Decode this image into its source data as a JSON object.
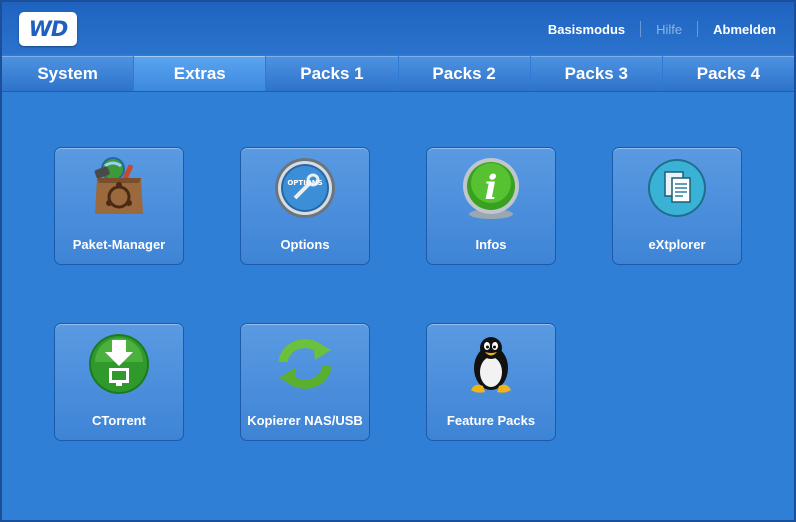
{
  "brand": {
    "logo_text": "WD"
  },
  "toplinks": {
    "basic_mode": "Basismodus",
    "help": "Hilfe",
    "logout": "Abmelden"
  },
  "tabs": [
    {
      "label": "System",
      "active": false
    },
    {
      "label": "Extras",
      "active": true
    },
    {
      "label": "Packs 1",
      "active": false
    },
    {
      "label": "Packs 2",
      "active": false
    },
    {
      "label": "Packs 3",
      "active": false
    },
    {
      "label": "Packs 4",
      "active": false
    }
  ],
  "tiles": [
    {
      "label": "Paket-Manager",
      "icon": "package-manager-icon"
    },
    {
      "label": "Options",
      "icon": "options-icon",
      "icon_text": "OPTIONS"
    },
    {
      "label": "Infos",
      "icon": "info-icon",
      "icon_text": "i"
    },
    {
      "label": "eXtplorer",
      "icon": "documents-icon"
    },
    {
      "label": "CTorrent",
      "icon": "download-icon"
    },
    {
      "label": "Kopierer NAS/USB",
      "icon": "sync-arrows-icon"
    },
    {
      "label": "Feature Packs",
      "icon": "tux-penguin-icon"
    }
  ],
  "colors": {
    "accent": "#2f7fd6",
    "header": "#1f63c0"
  }
}
